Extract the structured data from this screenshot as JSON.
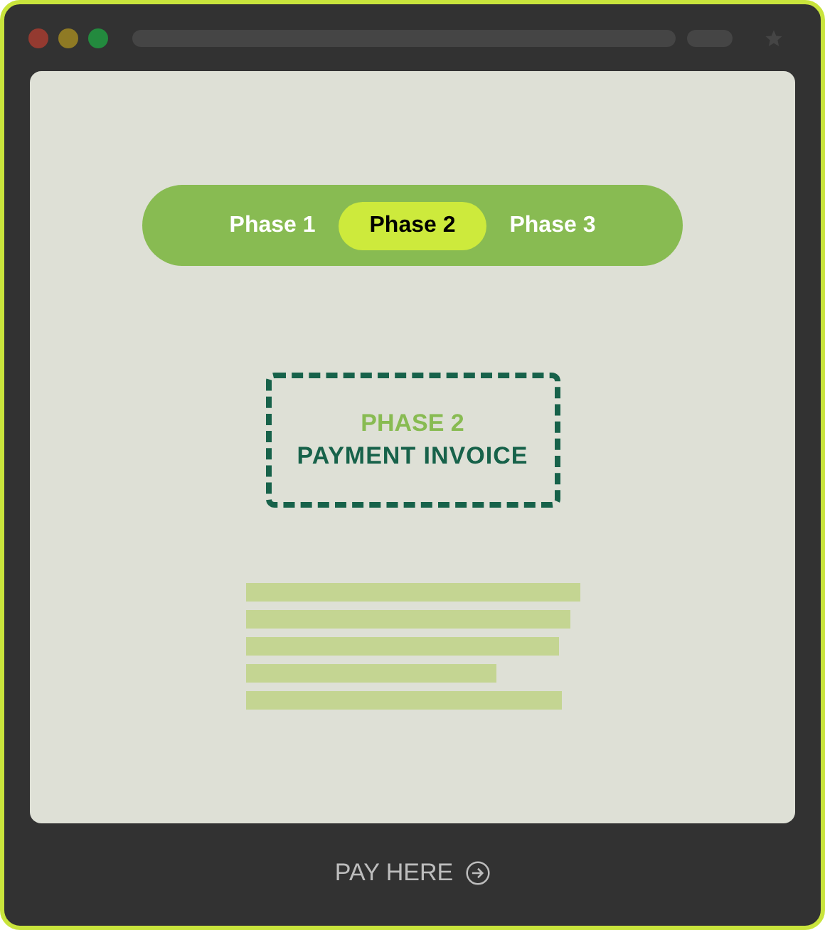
{
  "tabs": [
    {
      "label": "Phase 1",
      "selected": false
    },
    {
      "label": "Phase 2",
      "selected": true
    },
    {
      "label": "Phase 3",
      "selected": false
    }
  ],
  "card": {
    "eyebrow": "PHASE 2",
    "title": "PAYMENT INVOICE"
  },
  "footer": {
    "link": "PAY HERE"
  }
}
